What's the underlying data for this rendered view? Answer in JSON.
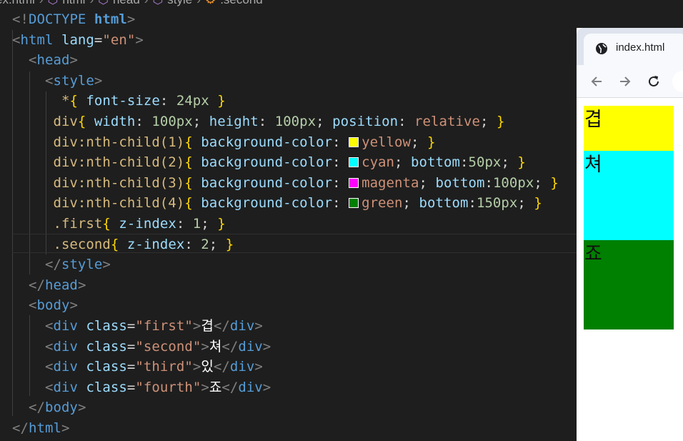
{
  "editor": {
    "breadcrumb": [
      "ex.html",
      "html",
      "head",
      "style",
      ".second"
    ],
    "lines": [
      [
        [
          "t-bracket",
          "<"
        ],
        [
          "t-bracket",
          "!"
        ],
        [
          "t-tag",
          "DOCTYPE "
        ],
        [
          "t-kw",
          "html"
        ],
        [
          "t-bracket",
          ">"
        ]
      ],
      [
        [
          "t-bracket",
          "<"
        ],
        [
          "t-tag",
          "html "
        ],
        [
          "t-attr",
          "lang"
        ],
        [
          "t-punc",
          "="
        ],
        [
          "t-val",
          "\"en\""
        ],
        [
          "t-bracket",
          ">"
        ]
      ],
      [
        [
          "t-punc",
          "  "
        ],
        [
          "t-bracket",
          "<"
        ],
        [
          "t-tag",
          "head"
        ],
        [
          "t-bracket",
          ">"
        ]
      ],
      [
        [
          "t-punc",
          "    "
        ],
        [
          "t-bracket",
          "<"
        ],
        [
          "t-tag",
          "style"
        ],
        [
          "t-bracket",
          ">"
        ]
      ],
      [
        [
          "t-punc",
          "      "
        ],
        [
          "t-sel",
          "*"
        ],
        [
          "t-brace",
          "{"
        ],
        [
          "t-attr",
          " font-size"
        ],
        [
          "t-punc",
          ": "
        ],
        [
          "t-num",
          "24px"
        ],
        [
          "t-brace",
          " }"
        ]
      ],
      [
        [
          "t-punc",
          "     "
        ],
        [
          "t-sel",
          "div"
        ],
        [
          "t-brace",
          "{"
        ],
        [
          "t-attr",
          " width"
        ],
        [
          "t-punc",
          ": "
        ],
        [
          "t-num",
          "100px"
        ],
        [
          "t-punc",
          "; "
        ],
        [
          "t-attr",
          "height"
        ],
        [
          "t-punc",
          ": "
        ],
        [
          "t-num",
          "100px"
        ],
        [
          "t-punc",
          "; "
        ],
        [
          "t-attr",
          "position"
        ],
        [
          "t-punc",
          ": "
        ],
        [
          "t-val",
          "relative"
        ],
        [
          "t-punc",
          "; "
        ],
        [
          "t-brace",
          "}"
        ]
      ],
      [
        [
          "t-punc",
          "     "
        ],
        [
          "t-sel",
          "div:nth-child(1)"
        ],
        [
          "t-brace",
          "{"
        ],
        [
          "t-attr",
          " background-color"
        ],
        [
          "t-punc",
          ": "
        ],
        [
          "swatch",
          "#ffff00"
        ],
        [
          "t-val",
          "yellow"
        ],
        [
          "t-punc",
          "; "
        ],
        [
          "t-brace",
          "}"
        ]
      ],
      [
        [
          "t-punc",
          "     "
        ],
        [
          "t-sel",
          "div:nth-child(2)"
        ],
        [
          "t-brace",
          "{"
        ],
        [
          "t-attr",
          " background-color"
        ],
        [
          "t-punc",
          ": "
        ],
        [
          "swatch",
          "#00ffff"
        ],
        [
          "t-val",
          "cyan"
        ],
        [
          "t-punc",
          "; "
        ],
        [
          "t-attr",
          "bottom"
        ],
        [
          "t-punc",
          ":"
        ],
        [
          "t-num",
          "50px"
        ],
        [
          "t-punc",
          "; "
        ],
        [
          "t-brace",
          "}"
        ]
      ],
      [
        [
          "t-punc",
          "     "
        ],
        [
          "t-sel",
          "div:nth-child(3)"
        ],
        [
          "t-brace",
          "{"
        ],
        [
          "t-attr",
          " background-color"
        ],
        [
          "t-punc",
          ": "
        ],
        [
          "swatch",
          "#ff00ff"
        ],
        [
          "t-val",
          "magenta"
        ],
        [
          "t-punc",
          "; "
        ],
        [
          "t-attr",
          "bottom"
        ],
        [
          "t-punc",
          ":"
        ],
        [
          "t-num",
          "100px"
        ],
        [
          "t-punc",
          "; "
        ],
        [
          "t-brace",
          "}"
        ]
      ],
      [
        [
          "t-punc",
          "     "
        ],
        [
          "t-sel",
          "div:nth-child(4)"
        ],
        [
          "t-brace",
          "{"
        ],
        [
          "t-attr",
          " background-color"
        ],
        [
          "t-punc",
          ": "
        ],
        [
          "swatch",
          "#008000"
        ],
        [
          "t-val",
          "green"
        ],
        [
          "t-punc",
          "; "
        ],
        [
          "t-attr",
          "bottom"
        ],
        [
          "t-punc",
          ":"
        ],
        [
          "t-num",
          "150px"
        ],
        [
          "t-punc",
          "; "
        ],
        [
          "t-brace",
          "}"
        ]
      ],
      [
        [
          "t-punc",
          "     "
        ],
        [
          "t-sel",
          ".first"
        ],
        [
          "t-brace",
          "{"
        ],
        [
          "t-attr",
          " z-index"
        ],
        [
          "t-punc",
          ": "
        ],
        [
          "t-num",
          "1"
        ],
        [
          "t-punc",
          "; "
        ],
        [
          "t-brace",
          "}"
        ]
      ],
      [
        [
          "t-punc",
          "     "
        ],
        [
          "t-sel",
          ".second"
        ],
        [
          "t-brace",
          "{"
        ],
        [
          "t-attr",
          " z-index"
        ],
        [
          "t-punc",
          ": "
        ],
        [
          "t-num",
          "2"
        ],
        [
          "t-punc",
          "; "
        ],
        [
          "t-brace",
          "}"
        ]
      ],
      [
        [
          "t-punc",
          "    "
        ],
        [
          "t-bracket",
          "</"
        ],
        [
          "t-tag",
          "style"
        ],
        [
          "t-bracket",
          ">"
        ]
      ],
      [
        [
          "t-punc",
          "  "
        ],
        [
          "t-bracket",
          "</"
        ],
        [
          "t-tag",
          "head"
        ],
        [
          "t-bracket",
          ">"
        ]
      ],
      [
        [
          "t-punc",
          "  "
        ],
        [
          "t-bracket",
          "<"
        ],
        [
          "t-tag",
          "body"
        ],
        [
          "t-bracket",
          ">"
        ]
      ],
      [
        [
          "t-punc",
          "    "
        ],
        [
          "t-bracket",
          "<"
        ],
        [
          "t-tag",
          "div "
        ],
        [
          "t-attr",
          "class"
        ],
        [
          "t-punc",
          "="
        ],
        [
          "t-val",
          "\"first\""
        ],
        [
          "t-bracket",
          ">"
        ],
        [
          "t-txt",
          "겹"
        ],
        [
          "t-bracket",
          "</"
        ],
        [
          "t-tag",
          "div"
        ],
        [
          "t-bracket",
          ">"
        ]
      ],
      [
        [
          "t-punc",
          "    "
        ],
        [
          "t-bracket",
          "<"
        ],
        [
          "t-tag",
          "div "
        ],
        [
          "t-attr",
          "class"
        ],
        [
          "t-punc",
          "="
        ],
        [
          "t-val",
          "\"second\""
        ],
        [
          "t-bracket",
          ">"
        ],
        [
          "t-txt",
          "쳐"
        ],
        [
          "t-bracket",
          "</"
        ],
        [
          "t-tag",
          "div"
        ],
        [
          "t-bracket",
          ">"
        ]
      ],
      [
        [
          "t-punc",
          "    "
        ],
        [
          "t-bracket",
          "<"
        ],
        [
          "t-tag",
          "div "
        ],
        [
          "t-attr",
          "class"
        ],
        [
          "t-punc",
          "="
        ],
        [
          "t-val",
          "\"third\""
        ],
        [
          "t-bracket",
          ">"
        ],
        [
          "t-txt",
          "있"
        ],
        [
          "t-bracket",
          "</"
        ],
        [
          "t-tag",
          "div"
        ],
        [
          "t-bracket",
          ">"
        ]
      ],
      [
        [
          "t-punc",
          "    "
        ],
        [
          "t-bracket",
          "<"
        ],
        [
          "t-tag",
          "div "
        ],
        [
          "t-attr",
          "class"
        ],
        [
          "t-punc",
          "="
        ],
        [
          "t-val",
          "\"fourth\""
        ],
        [
          "t-bracket",
          ">"
        ],
        [
          "t-txt",
          "죠"
        ],
        [
          "t-bracket",
          "</"
        ],
        [
          "t-tag",
          "div"
        ],
        [
          "t-bracket",
          ">"
        ]
      ],
      [
        [
          "t-punc",
          "  "
        ],
        [
          "t-bracket",
          "</"
        ],
        [
          "t-tag",
          "body"
        ],
        [
          "t-bracket",
          ">"
        ]
      ],
      [
        [
          "t-bracket",
          "</"
        ],
        [
          "t-tag",
          "html"
        ],
        [
          "t-bracket",
          ">"
        ]
      ]
    ]
  },
  "browser": {
    "tab_title": "index.html",
    "back_icon": "back-arrow-icon",
    "forward_icon": "forward-arrow-icon",
    "reload_icon": "reload-icon",
    "boxes": [
      {
        "text": "겹",
        "color": "#ffff00"
      },
      {
        "text": "쳐",
        "color": "#00ffff"
      },
      {
        "text": "죠",
        "color": "#008000"
      }
    ]
  }
}
